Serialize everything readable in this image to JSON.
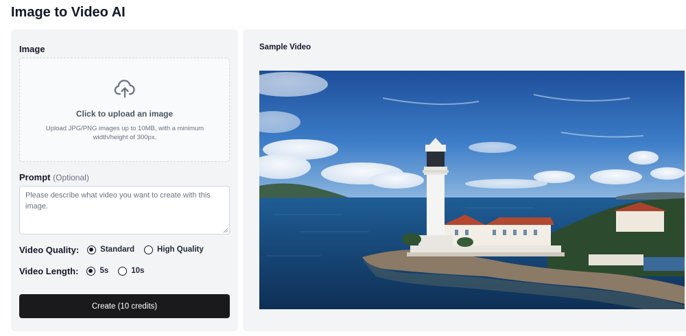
{
  "page": {
    "title": "Image to Video AI"
  },
  "image_section": {
    "label": "Image",
    "upload_title": "Click to upload an image",
    "upload_hint": "Upload JPG/PNG images up to 10MB, with a minimum width/height of 300px.",
    "icon": "cloud-upload-icon"
  },
  "prompt": {
    "label": "Prompt",
    "optional_tag": "(Optional)",
    "placeholder": "Please describe what video you want to create with this image.",
    "value": ""
  },
  "video_quality": {
    "label": "Video Quality:",
    "options": [
      {
        "label": "Standard",
        "selected": true
      },
      {
        "label": "High Quality",
        "selected": false
      }
    ]
  },
  "video_length": {
    "label": "Video Length:",
    "options": [
      {
        "label": "5s",
        "selected": true
      },
      {
        "label": "10s",
        "selected": false
      }
    ]
  },
  "create_button": {
    "label": "Create (10 credits)"
  },
  "sample": {
    "label": "Sample Video"
  },
  "colors": {
    "accent": "#1a1a1c",
    "panel_bg": "#f3f4f6",
    "text": "#111827"
  }
}
